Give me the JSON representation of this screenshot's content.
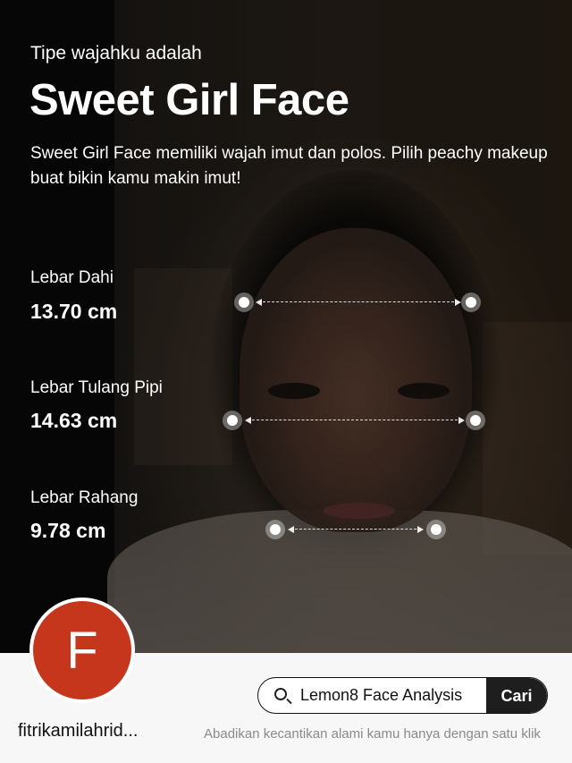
{
  "header": {
    "subtitle": "Tipe wajahku adalah",
    "title": "Sweet Girl Face",
    "description": "Sweet Girl Face memiliki wajah imut dan polos. Pilih peachy makeup buat bikin kamu makin imut!"
  },
  "metrics": [
    {
      "label": "Lebar Dahi",
      "value": "13.70 cm"
    },
    {
      "label": "Lebar Tulang Pipi",
      "value": "14.63 cm"
    },
    {
      "label": "Lebar Rahang",
      "value": "9.78 cm"
    }
  ],
  "profile": {
    "avatar_letter": "F",
    "avatar_color": "#c5361d",
    "username": "fitrikamilahrid..."
  },
  "search": {
    "query": "Lemon8 Face Analysis",
    "button_label": "Cari",
    "icon": "search-icon"
  },
  "tagline": "Abadikan kecantikan alami kamu hanya dengan satu klik"
}
